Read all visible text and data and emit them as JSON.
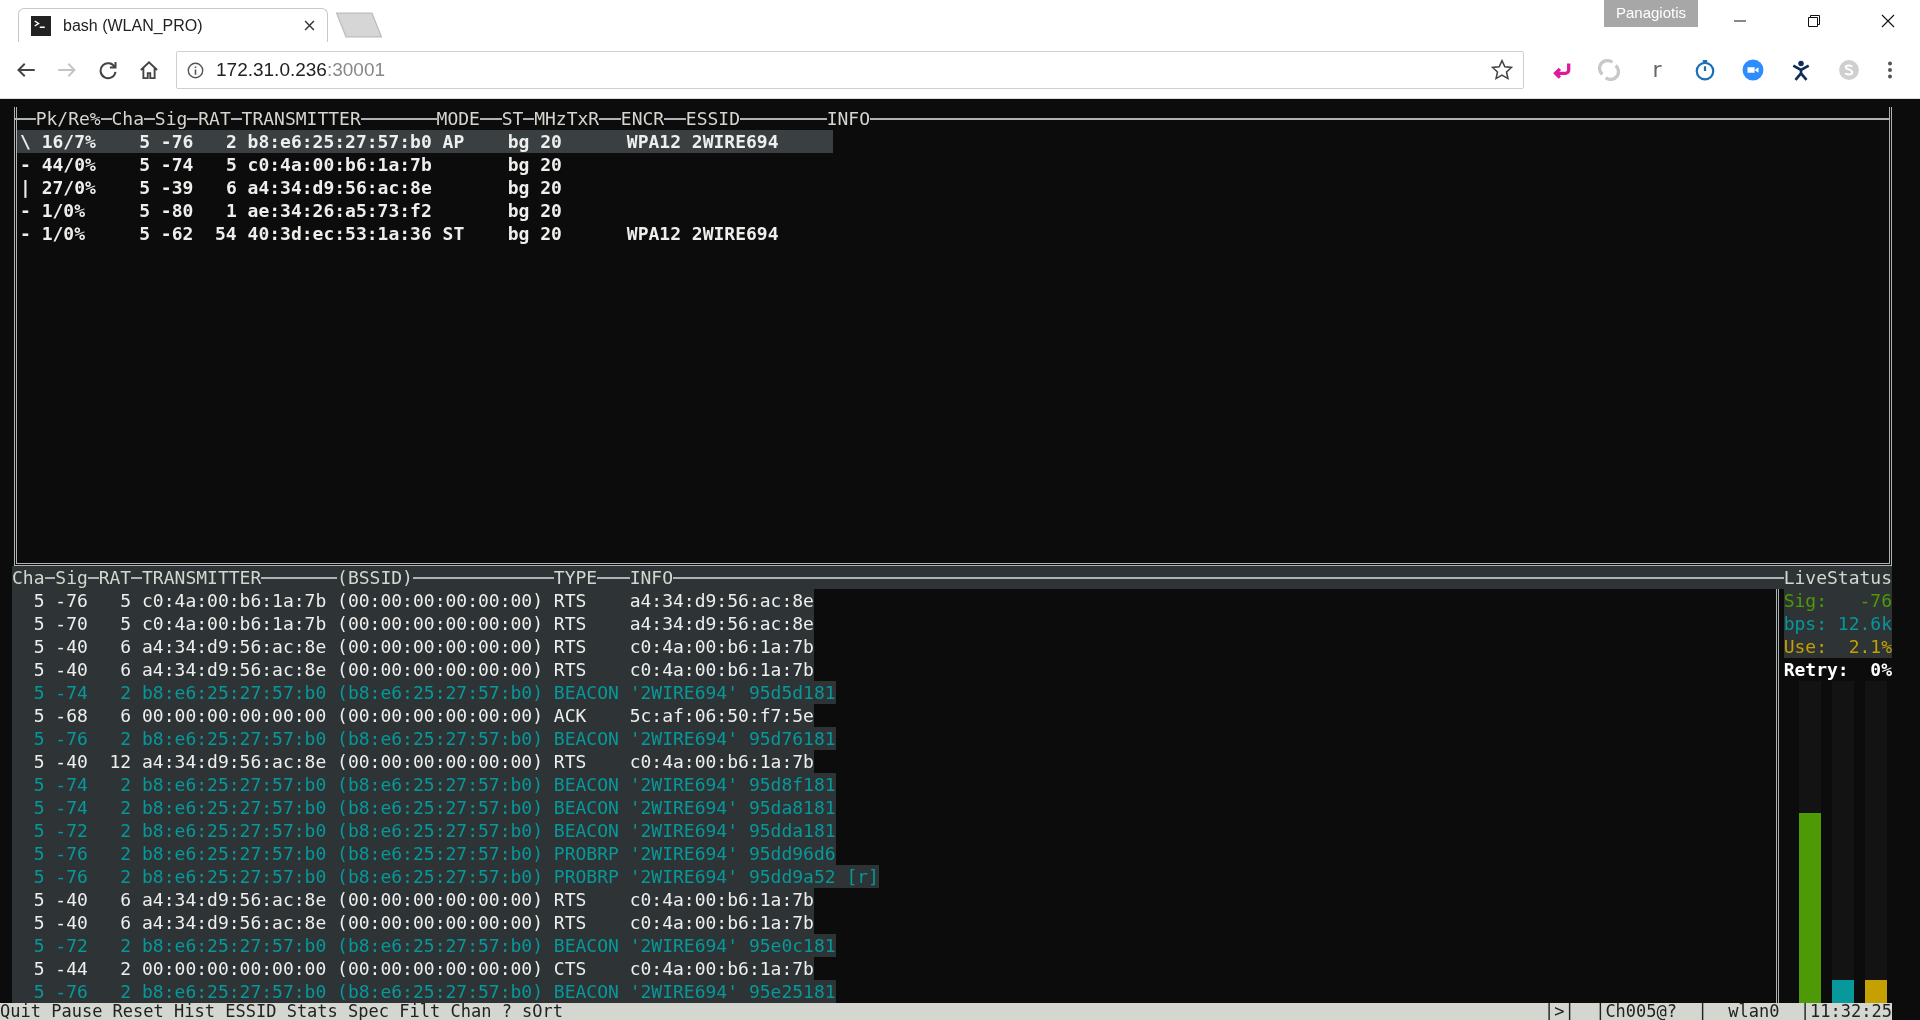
{
  "browser": {
    "tab": {
      "title": "bash (WLAN_PRO)"
    },
    "profile": "Panagiotis",
    "nav": [
      {
        "kind": "back",
        "disabled": false
      },
      {
        "kind": "forward",
        "disabled": true
      },
      {
        "kind": "reload",
        "disabled": false
      },
      {
        "kind": "home",
        "disabled": false
      }
    ],
    "address": {
      "host": "172.31.0.236",
      "port": ":30001"
    },
    "extensions": [
      {
        "kind": "arrow"
      },
      {
        "kind": "swirl"
      },
      {
        "kind": "letter",
        "text": "r"
      },
      {
        "kind": "timer"
      },
      {
        "kind": "camera"
      },
      {
        "kind": "figure"
      },
      {
        "kind": "badge"
      }
    ]
  },
  "stations": {
    "columns": [
      "Pk/Re%",
      "Cha",
      "Sig",
      "RAT",
      "TRANSMITTER",
      "MODE",
      "ST",
      "MHz",
      "TxR",
      "ENCR",
      "ESSID",
      "INFO"
    ],
    "rows": [
      {
        "marker": "\\",
        "pkre": "16/7%",
        "cha": "5",
        "sig": "-76",
        "rat": "2",
        "transmitter": "b8:e6:25:27:57:b0",
        "mode": "AP",
        "st": "bg",
        "mhz": "20",
        "encr": "WPA12",
        "essid": "2WIRE694",
        "selected": true
      },
      {
        "marker": "-",
        "pkre": "44/0%",
        "cha": "5",
        "sig": "-74",
        "rat": "5",
        "transmitter": "c0:4a:00:b6:1a:7b",
        "st": "bg",
        "mhz": "20",
        "selected": false
      },
      {
        "marker": "|",
        "pkre": "27/0%",
        "cha": "5",
        "sig": "-39",
        "rat": "6",
        "transmitter": "a4:34:d9:56:ac:8e",
        "st": "bg",
        "mhz": "20",
        "selected": false
      },
      {
        "marker": "-",
        "pkre": "1/0%",
        "cha": "5",
        "sig": "-80",
        "rat": "1",
        "transmitter": "ae:34:26:a5:73:f2",
        "st": "bg",
        "mhz": "20",
        "selected": false
      },
      {
        "marker": "-",
        "pkre": "1/0%",
        "cha": "5",
        "sig": "-62",
        "rat": "54",
        "transmitter": "40:3d:ec:53:1a:36",
        "mode": "ST",
        "st": "bg",
        "mhz": "20",
        "encr": "WPA12",
        "essid": "2WIRE694",
        "selected": false
      }
    ]
  },
  "packets": {
    "columns": [
      "Cha",
      "Sig",
      "RAT",
      "TRANSMITTER",
      "(BSSID)",
      "TYPE",
      "INFO"
    ],
    "rows": [
      {
        "cha": "5",
        "sig": "-76",
        "rat": "5",
        "transmitter": "c0:4a:00:b6:1a:7b",
        "bssid": "(00:00:00:00:00:00)",
        "type": "RTS",
        "info": "a4:34:d9:56:ac:8e",
        "color": "#eeeeec"
      },
      {
        "cha": "5",
        "sig": "-70",
        "rat": "5",
        "transmitter": "c0:4a:00:b6:1a:7b",
        "bssid": "(00:00:00:00:00:00)",
        "type": "RTS",
        "info": "a4:34:d9:56:ac:8e",
        "color": "#eeeeec"
      },
      {
        "cha": "5",
        "sig": "-40",
        "rat": "6",
        "transmitter": "a4:34:d9:56:ac:8e",
        "bssid": "(00:00:00:00:00:00)",
        "type": "RTS",
        "info": "c0:4a:00:b6:1a:7b",
        "color": "#eeeeec"
      },
      {
        "cha": "5",
        "sig": "-40",
        "rat": "6",
        "transmitter": "a4:34:d9:56:ac:8e",
        "bssid": "(00:00:00:00:00:00)",
        "type": "RTS",
        "info": "c0:4a:00:b6:1a:7b",
        "color": "#eeeeec"
      },
      {
        "cha": "5",
        "sig": "-74",
        "rat": "2",
        "transmitter": "b8:e6:25:27:57:b0",
        "bssid": "(b8:e6:25:27:57:b0)",
        "type": "BEACON",
        "info": "'2WIRE694' 95d5d181",
        "color": "#06989a"
      },
      {
        "cha": "5",
        "sig": "-68",
        "rat": "6",
        "transmitter": "00:00:00:00:00:00",
        "bssid": "(00:00:00:00:00:00)",
        "type": "ACK",
        "info": "5c:af:06:50:f7:5e",
        "color": "#eeeeec"
      },
      {
        "cha": "5",
        "sig": "-76",
        "rat": "2",
        "transmitter": "b8:e6:25:27:57:b0",
        "bssid": "(b8:e6:25:27:57:b0)",
        "type": "BEACON",
        "info": "'2WIRE694' 95d76181",
        "color": "#06989a"
      },
      {
        "cha": "5",
        "sig": "-40",
        "rat": "12",
        "transmitter": "a4:34:d9:56:ac:8e",
        "bssid": "(00:00:00:00:00:00)",
        "type": "RTS",
        "info": "c0:4a:00:b6:1a:7b",
        "color": "#eeeeec"
      },
      {
        "cha": "5",
        "sig": "-74",
        "rat": "2",
        "transmitter": "b8:e6:25:27:57:b0",
        "bssid": "(b8:e6:25:27:57:b0)",
        "type": "BEACON",
        "info": "'2WIRE694' 95d8f181",
        "color": "#06989a"
      },
      {
        "cha": "5",
        "sig": "-74",
        "rat": "2",
        "transmitter": "b8:e6:25:27:57:b0",
        "bssid": "(b8:e6:25:27:57:b0)",
        "type": "BEACON",
        "info": "'2WIRE694' 95da8181",
        "color": "#06989a"
      },
      {
        "cha": "5",
        "sig": "-72",
        "rat": "2",
        "transmitter": "b8:e6:25:27:57:b0",
        "bssid": "(b8:e6:25:27:57:b0)",
        "type": "BEACON",
        "info": "'2WIRE694' 95dda181",
        "color": "#06989a"
      },
      {
        "cha": "5",
        "sig": "-76",
        "rat": "2",
        "transmitter": "b8:e6:25:27:57:b0",
        "bssid": "(b8:e6:25:27:57:b0)",
        "type": "PROBRP",
        "info": "'2WIRE694' 95dd96d6",
        "color": "#06989a"
      },
      {
        "cha": "5",
        "sig": "-76",
        "rat": "2",
        "transmitter": "b8:e6:25:27:57:b0",
        "bssid": "(b8:e6:25:27:57:b0)",
        "type": "PROBRP",
        "info": "'2WIRE694' 95dd9a52 [r]",
        "color": "#06989a"
      },
      {
        "cha": "5",
        "sig": "-40",
        "rat": "6",
        "transmitter": "a4:34:d9:56:ac:8e",
        "bssid": "(00:00:00:00:00:00)",
        "type": "RTS",
        "info": "c0:4a:00:b6:1a:7b",
        "color": "#eeeeec"
      },
      {
        "cha": "5",
        "sig": "-40",
        "rat": "6",
        "transmitter": "a4:34:d9:56:ac:8e",
        "bssid": "(00:00:00:00:00:00)",
        "type": "RTS",
        "info": "c0:4a:00:b6:1a:7b",
        "color": "#eeeeec"
      },
      {
        "cha": "5",
        "sig": "-72",
        "rat": "2",
        "transmitter": "b8:e6:25:27:57:b0",
        "bssid": "(b8:e6:25:27:57:b0)",
        "type": "BEACON",
        "info": "'2WIRE694' 95e0c181",
        "color": "#06989a"
      },
      {
        "cha": "5",
        "sig": "-44",
        "rat": "2",
        "transmitter": "00:00:00:00:00:00",
        "bssid": "(00:00:00:00:00:00)",
        "type": "CTS",
        "info": "c0:4a:00:b6:1a:7b",
        "color": "#eeeeec"
      },
      {
        "cha": "5",
        "sig": "-76",
        "rat": "2",
        "transmitter": "b8:e6:25:27:57:b0",
        "bssid": "(b8:e6:25:27:57:b0)",
        "type": "BEACON",
        "info": "'2WIRE694' 95e25181",
        "color": "#06989a"
      }
    ]
  },
  "live": {
    "title": "LiveStatus",
    "metrics": [
      {
        "label": "Sig:",
        "value": "-76",
        "color": "#4e9a06",
        "level": 0.59
      },
      {
        "label": "bps:",
        "value": "12.6k",
        "color": "#06989a",
        "level": 0.07
      },
      {
        "label": "Use:",
        "value": "2.1%",
        "color": "#c4a000",
        "level": 0.07
      }
    ],
    "retry": {
      "label": "Retry:",
      "value": "0%"
    }
  },
  "status_bar": {
    "keys": [
      "Quit",
      "Pause",
      "Reset",
      "Hist",
      "ESSID",
      "Stats",
      "Spec",
      "Filt",
      "Chan",
      "?",
      "sOrt"
    ],
    "right": [
      "|>|",
      "|Ch005@?",
      "|",
      "wlan0",
      "|11:32:25"
    ]
  }
}
